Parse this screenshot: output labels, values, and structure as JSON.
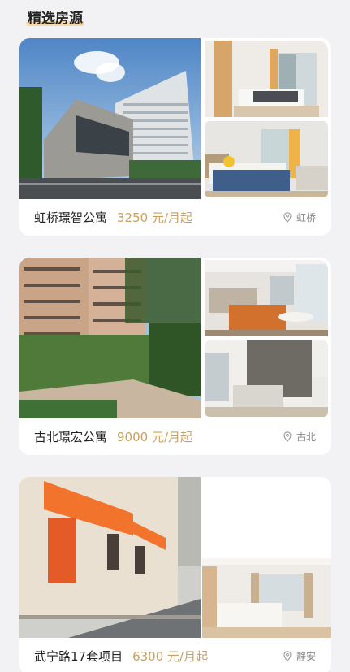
{
  "section": {
    "title": "精选房源"
  },
  "listings": [
    {
      "name": "虹桥璟智公寓",
      "price": "3250 元/月起",
      "location": "虹桥"
    },
    {
      "name": "古北璟宏公寓",
      "price": "9000 元/月起",
      "location": "古北"
    },
    {
      "name": "武宁路17套项目",
      "price": "6300 元/月起",
      "location": "静安"
    }
  ],
  "colors": {
    "accent": "#c8a063",
    "title_highlight": "#f5d7a8"
  },
  "icons": {
    "location": "map-pin-icon"
  }
}
